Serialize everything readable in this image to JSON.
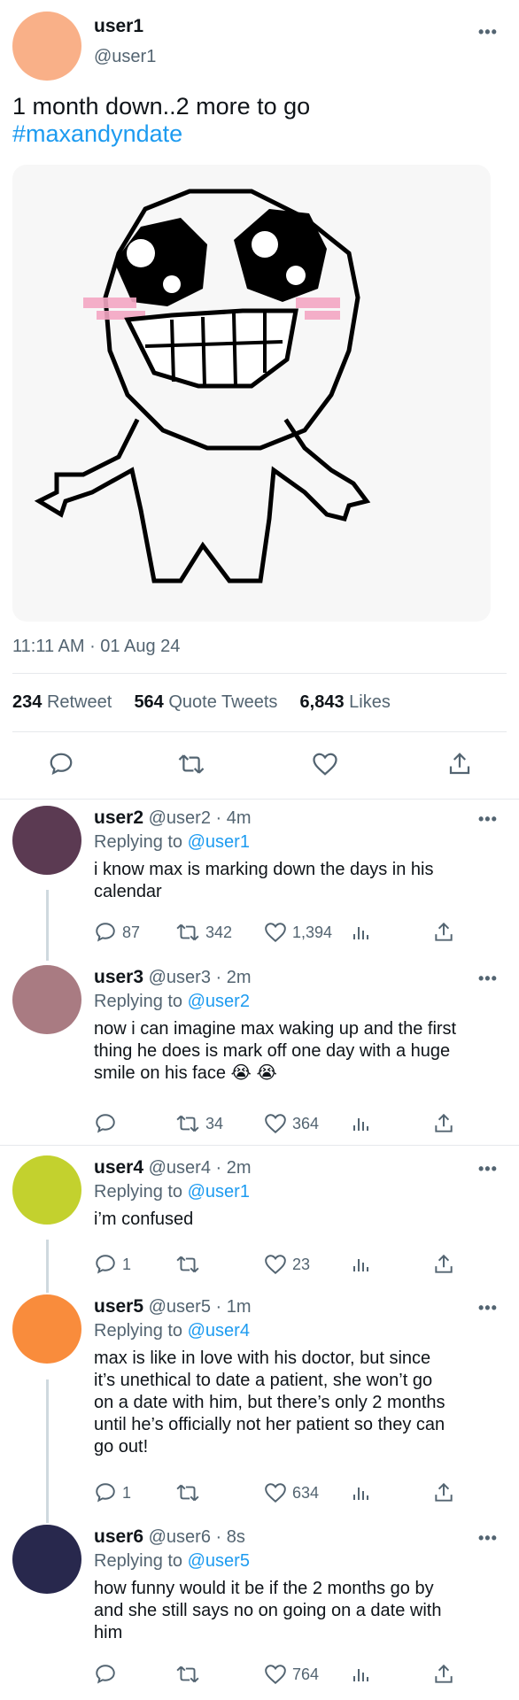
{
  "main_tweet": {
    "name": "user1",
    "handle": "@user1",
    "text": "1 month down..2 more to go",
    "hashtag": "#maxandyndate",
    "timestamp": "11:11 AM · 01 Aug 24",
    "stats": {
      "retweets": "234",
      "retweets_label": "Retweet",
      "quotes": "564",
      "quotes_label": "Quote Tweets",
      "likes": "6,843",
      "likes_label": "Likes"
    },
    "avatar_color": "#f9b088"
  },
  "replies": [
    {
      "name": "user2",
      "meta": "@user2 · 4m",
      "replying_label": "Replying to",
      "replying_to": "@user1",
      "lines": [
        "i know max is marking down the days in his",
        "calendar"
      ],
      "reply_count": "87",
      "retweet_count": "342",
      "like_count": "1,394",
      "avatar_color": "#5b3a52"
    },
    {
      "name": "user3",
      "meta": "@user3 · 2m",
      "replying_label": "Replying to",
      "replying_to": "@user2",
      "lines": [
        "now i can imagine max waking up and the first",
        "thing he does is mark off one day with a huge",
        "smile on his face 😭 😭"
      ],
      "reply_count": "",
      "retweet_count": "34",
      "like_count": "364",
      "avatar_color": "#a97b82"
    },
    {
      "name": "user4",
      "meta": "@user4 · 2m",
      "replying_label": "Replying to",
      "replying_to": "@user1",
      "lines": [
        "i’m confused"
      ],
      "reply_count": "1",
      "retweet_count": "",
      "like_count": "23",
      "avatar_color": "#c3d12e"
    },
    {
      "name": "user5",
      "meta": "@user5 · 1m",
      "replying_label": "Replying to",
      "replying_to": "@user4",
      "lines": [
        "max is like in love with his doctor, but since",
        "it’s unethical to date a patient, she won’t go",
        "on a date with him, but there’s only 2 months",
        "until he’s officially not her patient so they can",
        "go out!"
      ],
      "reply_count": "1",
      "retweet_count": "",
      "like_count": "634",
      "avatar_color": "#f98c3c"
    },
    {
      "name": "user6",
      "meta": "@user6 · 8s",
      "replying_label": "Replying to",
      "replying_to": "@user5",
      "lines": [
        "how funny would it be if the 2 months go by",
        "and she still says no on going on a date with",
        "him"
      ],
      "reply_count": "",
      "retweet_count": "",
      "like_count": "764",
      "avatar_color": "#28284d"
    }
  ],
  "colors": {
    "accent": "#1d9bf0",
    "secondary": "#536471",
    "blush": "#f4a7c4"
  }
}
